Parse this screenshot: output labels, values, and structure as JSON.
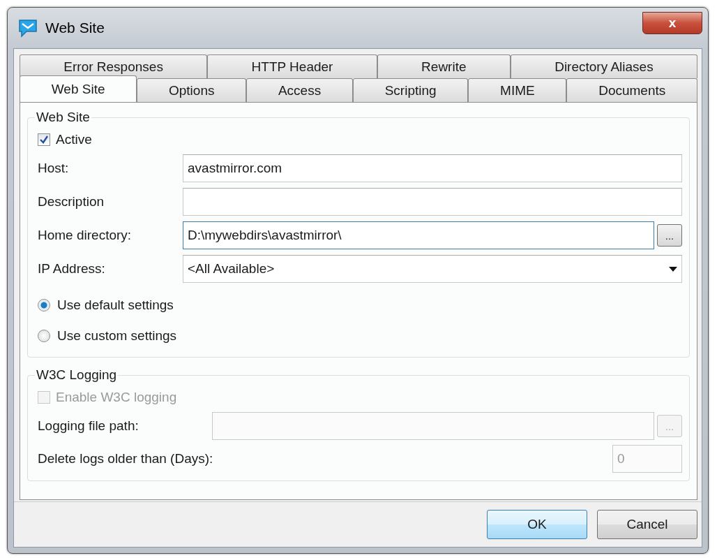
{
  "window": {
    "title": "Web Site",
    "close_label": "x"
  },
  "tabs": [
    [
      {
        "label": "Error Responses",
        "selected": false
      },
      {
        "label": "HTTP Header",
        "selected": false
      },
      {
        "label": "Rewrite",
        "selected": false
      },
      {
        "label": "Directory Aliases",
        "selected": false
      }
    ],
    [
      {
        "label": "Web Site",
        "selected": true
      },
      {
        "label": "Options",
        "selected": false
      },
      {
        "label": "Access",
        "selected": false
      },
      {
        "label": "Scripting",
        "selected": false
      },
      {
        "label": "MIME",
        "selected": false
      },
      {
        "label": "Documents",
        "selected": false
      }
    ]
  ],
  "web_site": {
    "title": "Web Site",
    "active": {
      "label": "Active",
      "checked": true
    },
    "fields": [
      {
        "kind": "text",
        "label": "Host:",
        "value": "avastmirror.com",
        "focused": false
      },
      {
        "kind": "text",
        "label": "Description",
        "focused": false
      },
      {
        "kind": "browse",
        "label": "Home directory:",
        "value": "D:\\mywebdirs\\avastmirror\\",
        "button": "...",
        "focused": true
      },
      {
        "kind": "dropdown",
        "label": "IP Address:",
        "value": "<All Available>",
        "focused": false
      }
    ],
    "radios": [
      {
        "label": "Use default settings",
        "selected": true
      },
      {
        "label": "Use custom settings",
        "selected": false
      }
    ]
  },
  "w3c_logging": {
    "title": "W3C Logging",
    "enable": {
      "label": "Enable W3C logging",
      "checked": false,
      "disabled": true
    },
    "path": {
      "label": "Logging file path:",
      "button": "...",
      "disabled": true
    },
    "days": {
      "label": "Delete logs older than (Days):",
      "value": "0",
      "disabled": true
    }
  },
  "buttons": [
    {
      "label": "OK",
      "default": true
    },
    {
      "label": "Cancel",
      "default": false
    }
  ]
}
